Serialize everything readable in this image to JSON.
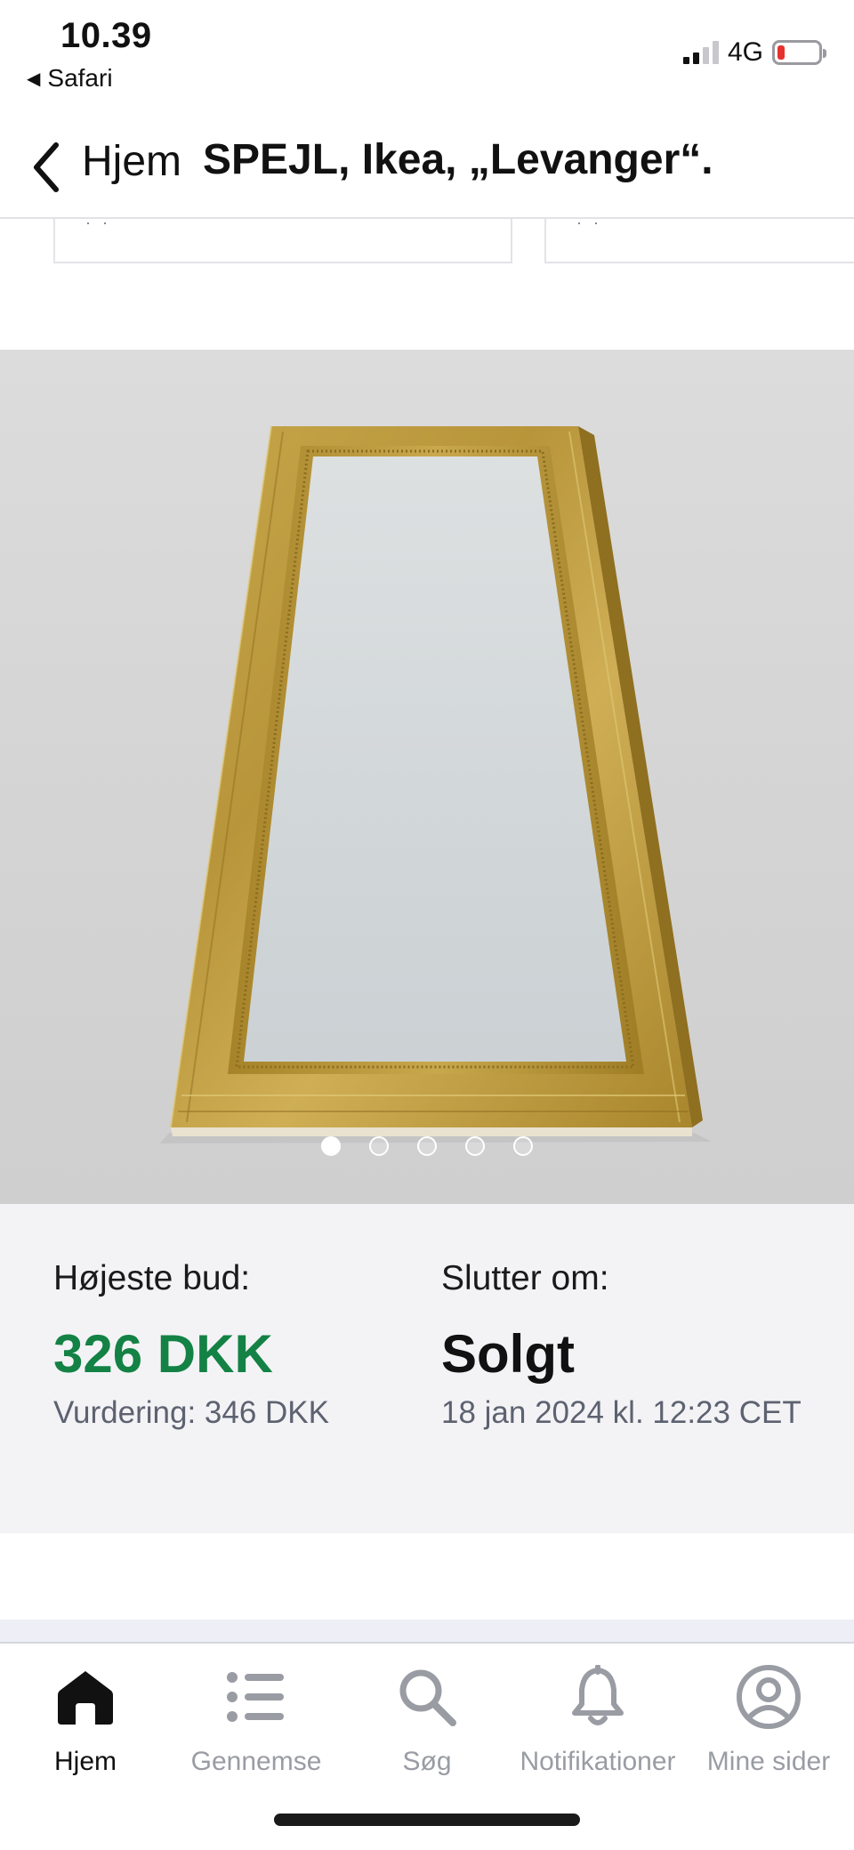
{
  "status_bar": {
    "time": "10.39",
    "back_app": "Safari",
    "network": "4G"
  },
  "nav": {
    "back_label": "Hjem",
    "title": "SPEJL, Ikea, „Levanger“."
  },
  "carousel": {
    "image_count": 5,
    "active_index": 0
  },
  "bid": {
    "highest_label": "Højeste bud:",
    "highest_value": "326 DKK",
    "valuation": "Vurdering: 346 DKK",
    "ends_label": "Slutter om:",
    "ends_value": "Solgt",
    "ends_date": "18 jan 2024 kl. 12:23 CET"
  },
  "tabs": [
    {
      "label": "Hjem",
      "icon": "home-icon",
      "active": true
    },
    {
      "label": "Gennemse",
      "icon": "list-icon",
      "active": false
    },
    {
      "label": "Søg",
      "icon": "search-icon",
      "active": false
    },
    {
      "label": "Notifikationer",
      "icon": "bell-icon",
      "active": false
    },
    {
      "label": "Mine sider",
      "icon": "profile-icon",
      "active": false
    }
  ],
  "colors": {
    "price_green": "#138244",
    "battery_low": "#e5322d",
    "tab_inactive": "#9a9ca4",
    "section_bg": "#f3f3f6"
  }
}
